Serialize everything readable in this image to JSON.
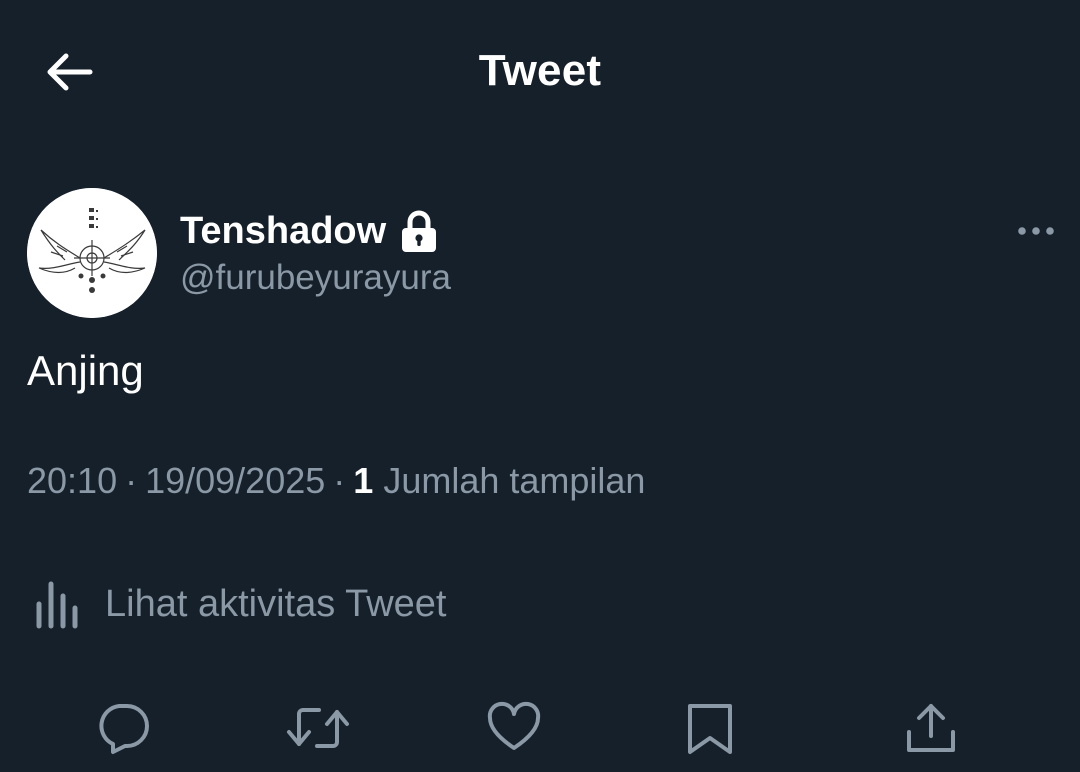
{
  "header": {
    "title": "Tweet",
    "back_icon": "arrow-left-icon"
  },
  "tweet": {
    "author": {
      "display_name": "Tenshadow",
      "handle": "@furubeyurayura",
      "protected_icon": "lock-icon",
      "avatar": "avatar"
    },
    "text": "Anjing",
    "time": "20:10",
    "date": "19/09/2025",
    "separator": "·",
    "view_count": "1",
    "views_label": "Jumlah tampilan"
  },
  "activity": {
    "label": "Lihat aktivitas Tweet",
    "icon": "bar-chart-icon"
  },
  "actions": [
    {
      "name": "reply",
      "icon": "reply-icon"
    },
    {
      "name": "retweet",
      "icon": "retweet-icon"
    },
    {
      "name": "like",
      "icon": "heart-icon"
    },
    {
      "name": "bookmark",
      "icon": "bookmark-icon"
    },
    {
      "name": "share",
      "icon": "share-icon"
    }
  ],
  "colors": {
    "background": "#15202b",
    "primary_text": "#ffffff",
    "secondary_text": "#8b98a5"
  }
}
